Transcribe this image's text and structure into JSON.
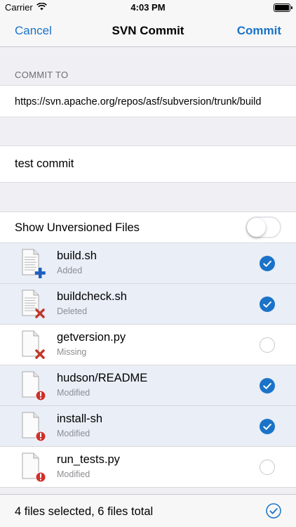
{
  "status_bar": {
    "carrier": "Carrier",
    "time": "4:03 PM"
  },
  "nav": {
    "cancel_label": "Cancel",
    "title": "SVN Commit",
    "commit_label": "Commit"
  },
  "commit_to": {
    "header": "COMMIT TO",
    "url": "https://svn.apache.org/repos/asf/subversion/trunk/build"
  },
  "message": {
    "value": "test commit"
  },
  "unversioned": {
    "label": "Show Unversioned Files",
    "enabled": false
  },
  "files": [
    {
      "name": "build.sh",
      "status": "Added",
      "selected": true,
      "icon": "file-added-icon"
    },
    {
      "name": "buildcheck.sh",
      "status": "Deleted",
      "selected": true,
      "icon": "file-deleted-icon"
    },
    {
      "name": "getversion.py",
      "status": "Missing",
      "selected": false,
      "icon": "file-missing-icon"
    },
    {
      "name": "hudson/README",
      "status": "Modified",
      "selected": true,
      "icon": "file-modified-icon"
    },
    {
      "name": "install-sh",
      "status": "Modified",
      "selected": true,
      "icon": "file-modified-icon"
    },
    {
      "name": "run_tests.py",
      "status": "Modified",
      "selected": false,
      "icon": "file-modified-icon"
    }
  ],
  "footer": {
    "summary": "4 files selected, 6 files total"
  },
  "colors": {
    "accent": "#1a73c8",
    "selected_row": "#e9eef7",
    "add_badge": "#1e5fc0",
    "delete_badge": "#c0392b",
    "modified_badge": "#d0302a"
  }
}
